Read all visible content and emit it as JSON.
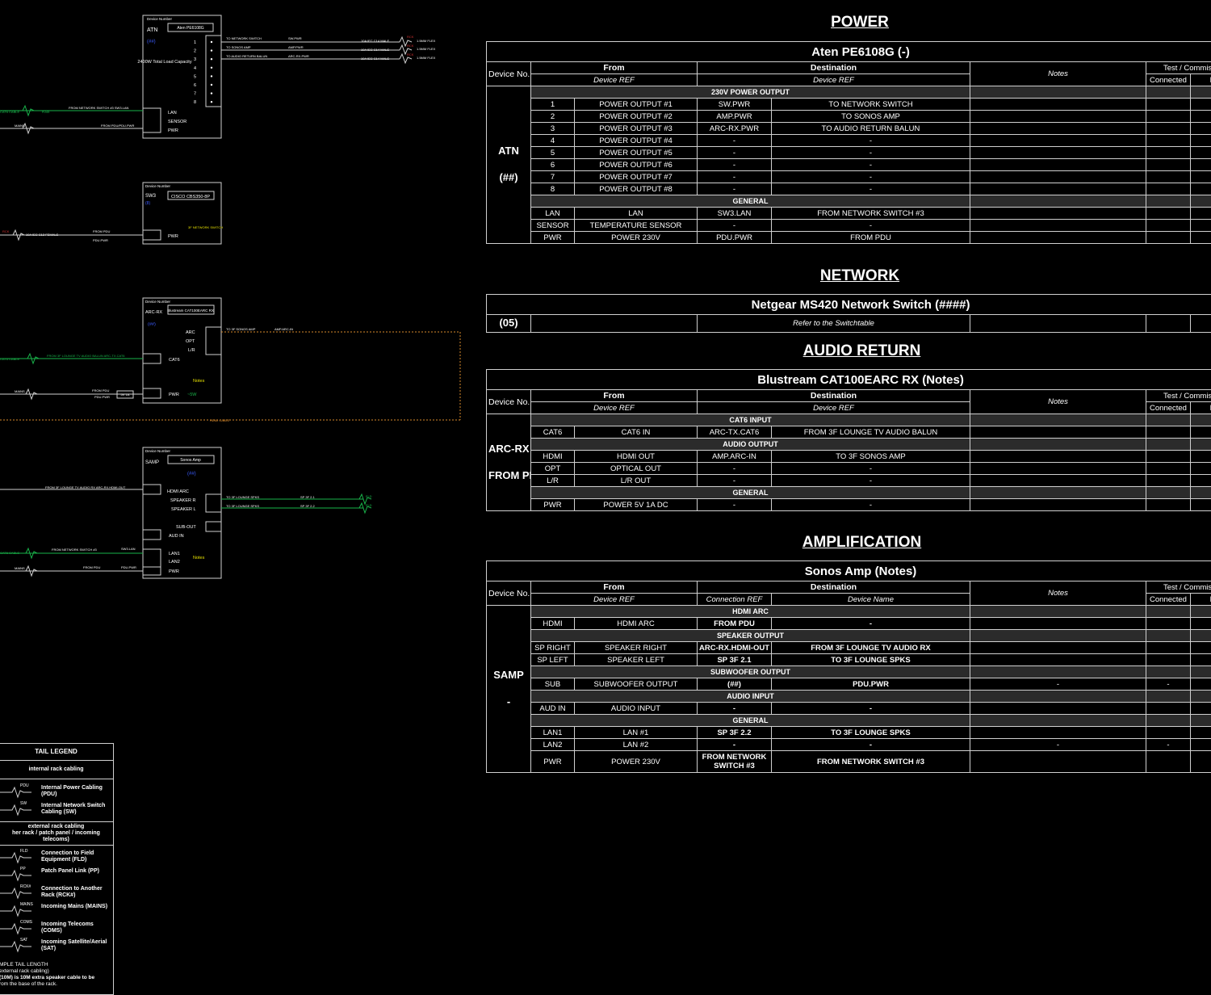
{
  "sections": {
    "power": "POWER",
    "network": "NETWORK",
    "audio_return": "AUDIO RETURN",
    "amplification": "AMPLIFICATION"
  },
  "columns": {
    "device_no": "Device No.",
    "from": "From",
    "destination": "Destination",
    "notes": "Notes",
    "test": "Test / Commissi",
    "connected": "Connected",
    "d": "D",
    "device_ref": "Device REF",
    "connection_ref": "Connection REF",
    "device_name": "Device Name"
  },
  "power_table": {
    "title": "Aten PE6108G    (-)",
    "device": "ATN",
    "device_sub": "(##)",
    "section1": "230V POWER OUTPUT",
    "rows1": [
      {
        "port": "1",
        "from": "POWER OUTPUT #1",
        "ref": "SW.PWR",
        "dest": "TO NETWORK SWITCH"
      },
      {
        "port": "2",
        "from": "POWER OUTPUT #2",
        "ref": "AMP.PWR",
        "dest": "TO SONOS AMP"
      },
      {
        "port": "3",
        "from": "POWER OUTPUT #3",
        "ref": "ARC-RX.PWR",
        "dest": "TO AUDIO RETURN BALUN"
      },
      {
        "port": "4",
        "from": "POWER OUTPUT #4",
        "ref": "-",
        "dest": "-"
      },
      {
        "port": "5",
        "from": "POWER OUTPUT #5",
        "ref": "-",
        "dest": "-"
      },
      {
        "port": "6",
        "from": "POWER OUTPUT #6",
        "ref": "-",
        "dest": "-"
      },
      {
        "port": "7",
        "from": "POWER OUTPUT #7",
        "ref": "-",
        "dest": "-"
      },
      {
        "port": "8",
        "from": "POWER OUTPUT #8",
        "ref": "-",
        "dest": "-"
      }
    ],
    "section2": "GENERAL",
    "rows2": [
      {
        "port": "LAN",
        "from": "LAN",
        "ref": "SW3.LAN",
        "dest": "FROM NETWORK SWITCH #3"
      },
      {
        "port": "SENSOR",
        "from": "TEMPERATURE SENSOR",
        "ref": "-",
        "dest": "-"
      },
      {
        "port": "PWR",
        "from": "POWER 230V",
        "ref": "PDU.PWR",
        "dest": "FROM PDU"
      }
    ]
  },
  "network_table": {
    "title": "Netgear MS420 Network Switch    (####)",
    "device": "(05)",
    "note": "Refer to the Switchtable"
  },
  "arc_table": {
    "title": "Blustream CAT100EARC RX    (Notes)",
    "device": "ARC-RX",
    "device_sub": "FROM PDU",
    "section1": "CAT6 INPUT",
    "rows1": [
      {
        "port": "CAT6",
        "from": "CAT6 IN",
        "ref": "ARC-TX.CAT6",
        "dest": "FROM 3F LOUNGE TV AUDIO BALUN"
      }
    ],
    "section2": "AUDIO OUTPUT",
    "rows2": [
      {
        "port": "HDMI",
        "from": "HDMI OUT",
        "ref": "AMP.ARC-IN",
        "dest": "TO 3F SONOS AMP"
      },
      {
        "port": "OPT",
        "from": "OPTICAL OUT",
        "ref": "-",
        "dest": "-"
      },
      {
        "port": "L/R",
        "from": "L/R OUT",
        "ref": "-",
        "dest": "-"
      }
    ],
    "section3": "GENERAL",
    "rows3": [
      {
        "port": "PWR",
        "from": "POWER 5V 1A DC",
        "ref": "-",
        "dest": "-"
      }
    ]
  },
  "amp_table": {
    "title": "Sonos Amp    (Notes)",
    "device": "SAMP",
    "device_sub": "-",
    "section1": "HDMI ARC",
    "rows1": [
      {
        "port": "HDMI",
        "from": "HDMI ARC",
        "ref": "FROM PDU",
        "dest": "-",
        "n": "",
        "c": ""
      }
    ],
    "section2": "SPEAKER OUTPUT",
    "rows2": [
      {
        "port": "SP RIGHT",
        "from": "SPEAKER RIGHT",
        "ref": "ARC-RX.HDMI-OUT",
        "dest": "FROM 3F LOUNGE TV AUDIO RX",
        "n": "",
        "c": ""
      },
      {
        "port": "SP LEFT",
        "from": "SPEAKER LEFT",
        "ref": "SP 3F 2.1",
        "dest": "TO 3F LOUNGE SPKS",
        "n": "",
        "c": ""
      }
    ],
    "section3": "SUBWOOFER OUTPUT",
    "rows3": [
      {
        "port": "SUB",
        "from": "SUBWOOFER OUTPUT",
        "ref": "(##)",
        "dest": "PDU.PWR",
        "n": "-",
        "c": "-"
      }
    ],
    "section4": "AUDIO INPUT",
    "rows4": [
      {
        "port": "AUD IN",
        "from": "AUDIO INPUT",
        "ref": "-",
        "dest": "-",
        "n": "",
        "c": ""
      }
    ],
    "section5": "GENERAL",
    "rows5": [
      {
        "port": "LAN1",
        "from": "LAN #1",
        "ref": "SP 3F 2.2",
        "dest": "TO 3F LOUNGE SPKS",
        "n": "",
        "c": ""
      },
      {
        "port": "LAN2",
        "from": "LAN #2",
        "ref": "-",
        "dest": "-",
        "n": "-",
        "c": "-"
      },
      {
        "port": "PWR",
        "from": "POWER 230V",
        "ref": "FROM NETWORK SWITCH #3",
        "dest": "FROM NETWORK SWITCH #3",
        "n": "",
        "c": ""
      }
    ]
  },
  "legend": {
    "title": "TAIL LEGEND",
    "internal": "internal rack cabling",
    "items_internal": [
      {
        "tag": "PDU",
        "text": "Internal Power Cabling (PDU)"
      },
      {
        "tag": "SW",
        "text": "Internal Network Switch Cabling (SW)"
      }
    ],
    "external": "external rack cabling",
    "external_sub": "her rack / patch panel / incoming telecoms)",
    "items_external": [
      {
        "tag": "FLD",
        "text": "Connection to Field Equipment (FLD)"
      },
      {
        "tag": "PP",
        "text": "Patch Panel Link (PP)"
      },
      {
        "tag": "RCK#",
        "text": "Connection to Another Rack (RCK#)"
      },
      {
        "tag": "MAINS",
        "text": "Incoming Mains (MAINS)"
      },
      {
        "tag": "COMS",
        "text": "Incoming Telecoms (COMS)"
      },
      {
        "tag": "SAT",
        "text": "Incoming Satellite/Aerial (SAT)"
      }
    ],
    "foot1": "MPLE TAIL LENGTH",
    "foot2": "external rack cabling)",
    "foot3": "(10M) is 10M extra speaker cable to be",
    "foot4": "rom the base of the rack."
  },
  "schematic": {
    "atn": {
      "lbl": "Device Number",
      "id": "ATN",
      "sub": "(##)",
      "model": "Aten PE6108G",
      "load": "2400W Total Load Capacity",
      "ports": [
        "1",
        "2",
        "3",
        "4",
        "5",
        "6",
        "7",
        "8"
      ],
      "p_lan": "LAN",
      "p_sensor": "SENSOR",
      "p_pwr": "PWR",
      "out1": "TO NETWORK SWITCH",
      "out2": "TO SONOS AMP",
      "out3": "TO AUDIO RETURN BALUN",
      "ref1": "SW.PWR",
      "ref2": "AMP.PWR",
      "ref3": "ARC-RX.PWR",
      "cable1": "10A IEC C14 MALE",
      "tag1": "RCK",
      "len1": "1.5MM FLEX",
      "in_lan": "FROM NETWORK SWITCH #3  SW3.LAN",
      "in_pwr": "FROM PDU/PDU.PWR",
      "cat6": "CAT6 CABLE",
      "rj45": "RJ45",
      "mains": "MAINS"
    },
    "sw3": {
      "lbl": "Device Number",
      "id": "SW3",
      "sub": "(8)",
      "model": "CISCO CBS350-8P",
      "p_pwr": "PWR",
      "note": "3F NETWORK SWITCH",
      "in": "FROM PDU",
      "in_ref": "PDU.PWR",
      "cable": "10A IEC C13 FEMALE",
      "tag": "RCK"
    },
    "arc": {
      "lbl": "Device Number",
      "id": "ARC-RX",
      "sub": "(##)",
      "model": "Blustream CAT100EARC RX",
      "p_arc": "ARC",
      "p_opt": "OPT",
      "p_lr": "L/R",
      "p_cat6": "CAT6",
      "p_pwr": "PWR",
      "pwr_v": "~5W",
      "notes": "Notes",
      "out": "TO 3F SONOS AMP",
      "out_ref": "AMP.ARC-IN",
      "in": "FROM 3F LOUNGE TV AUDIO BALUN  ARC-TX.CAT6",
      "in_pwr": "FROM PDU",
      "in_pwr_ref": "PDU.PWR",
      "psu": "5V 1A",
      "hdmi": "HDMI CABLE"
    },
    "samp": {
      "lbl": "Device Number",
      "id": "SAMP",
      "sub": "(##)",
      "model": "Sonos Amp",
      "p_hdmi": "HDMI ARC",
      "p_spr": "SPEAKER R",
      "p_spl": "SPEAKER L",
      "p_sub": "SUB-OUT",
      "p_aud": "AUD IN",
      "p_lan1": "LAN1",
      "p_lan2": "LAN2",
      "p_pwr": "PWR",
      "notes": "Notes",
      "in_hdmi": "FROM 3F LOUNGE TV AUDIO RX  ARC-RX.HDMI-OUT",
      "spk1": "TO 3F LOUNGE SPKS",
      "spk2": "TO 3F LOUNGE SPKS",
      "ref1": "SP 3F 2.1",
      "ref2": "SP 3F 2.2",
      "tag": "FLD",
      "in_lan": "FROM NETWORK SWITCH #3",
      "in_lan_ref": "SW3.LAN",
      "in_pwr": "FROM PDU",
      "in_pwr_ref": "PDU.PWR"
    }
  },
  "colors": {
    "green": "#19b34a",
    "red": "#d23030",
    "orange": "#d98a2b",
    "blue": "#3a5bff",
    "yellow": "#e6e000",
    "line": "#d0d0d0"
  }
}
